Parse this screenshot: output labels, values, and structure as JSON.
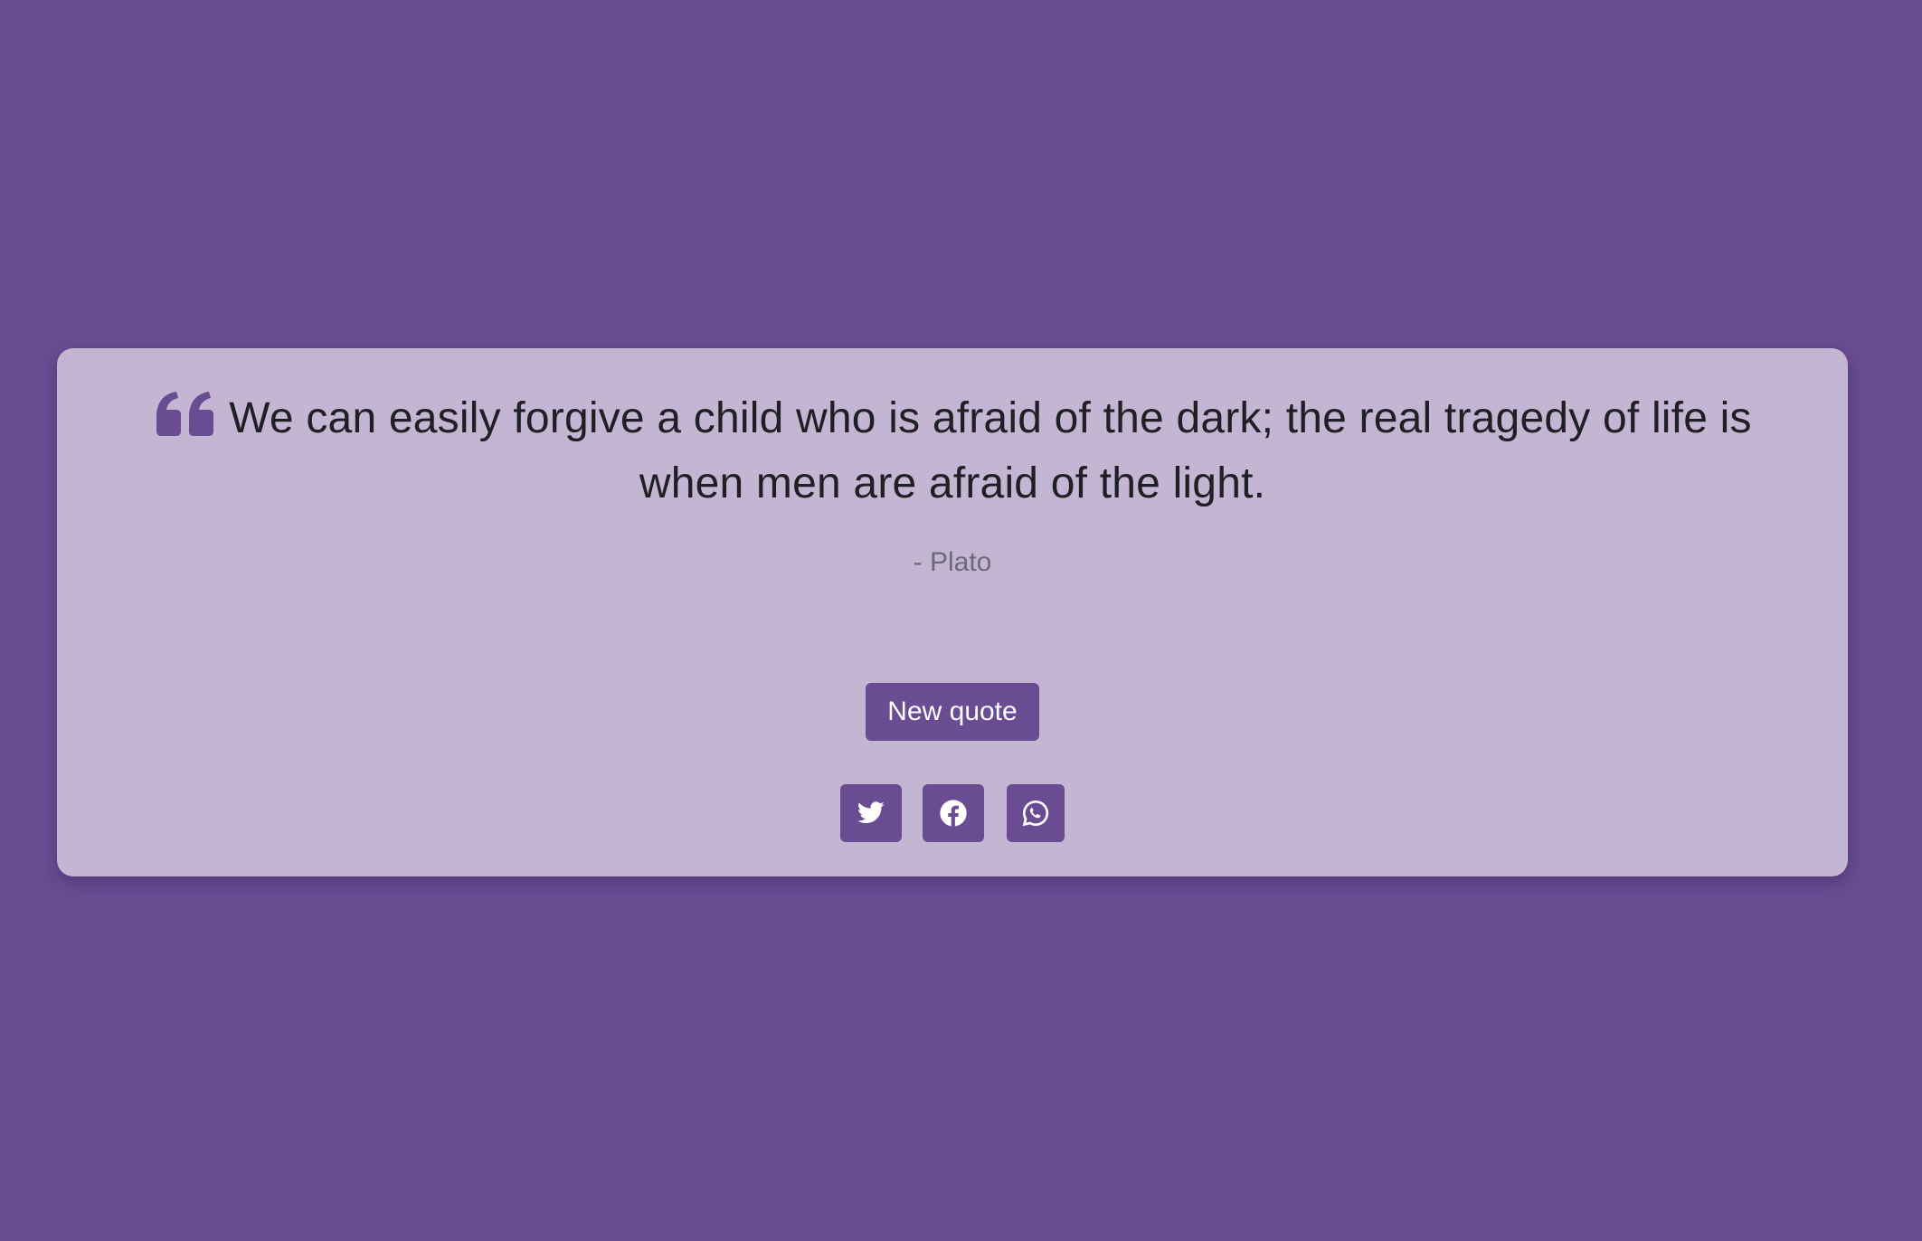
{
  "quote": {
    "text": "We can easily forgive a child who is afraid of the dark; the real tragedy of life is when men are afraid of the light.",
    "author": "- Plato",
    "icon": "quote-left-icon"
  },
  "actions": {
    "new_quote_label": "New quote"
  },
  "share": [
    {
      "name": "twitter",
      "icon": "twitter-icon"
    },
    {
      "name": "facebook",
      "icon": "facebook-icon"
    },
    {
      "name": "whatsapp",
      "icon": "whatsapp-icon"
    }
  ],
  "colors": {
    "background": "#6a4c93",
    "card": "#c4b5d3",
    "accent": "#6a4c93",
    "text": "#1f1f24",
    "author": "#6c6a78"
  }
}
